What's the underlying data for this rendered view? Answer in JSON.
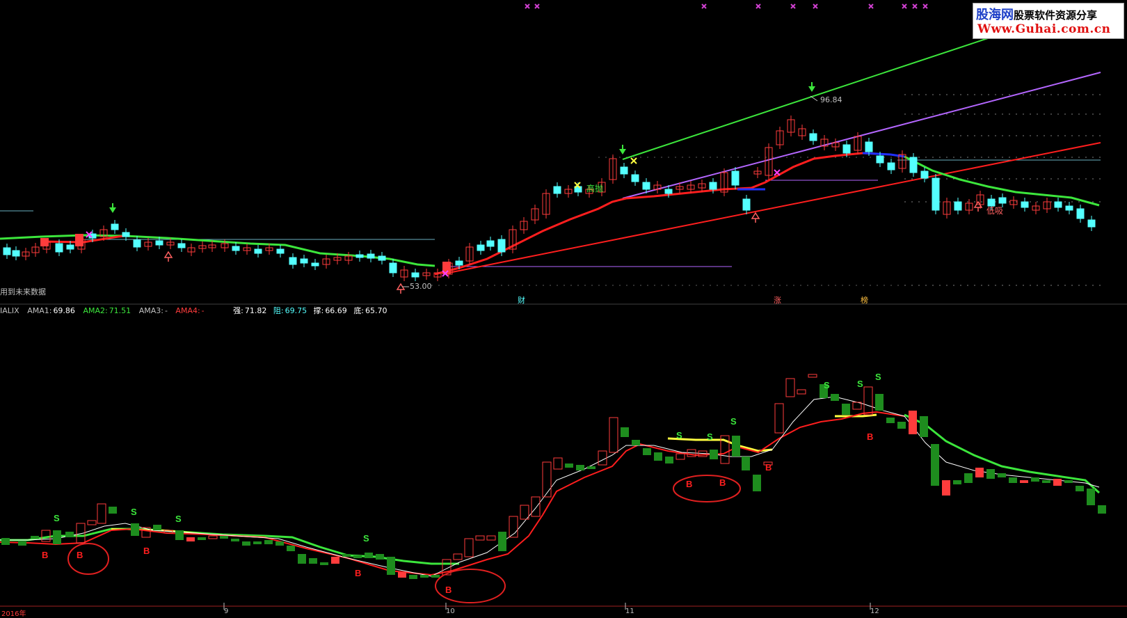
{
  "watermark": {
    "line1_a": "股海网",
    "line1_b": "股票软件资源分享",
    "line2": "Www.Guhai.com.cn"
  },
  "main_panel": {
    "note_left": "用到未来数据",
    "price_high_label": "96.84",
    "price_low_label": "53.00",
    "label_high_sell": "高抛",
    "label_low_buy": "低吸",
    "event_labels": [
      "财",
      "涨",
      "榜"
    ]
  },
  "indicator_bar": {
    "name": "IALIX",
    "ama1_label": "AMA1:",
    "ama1_value": "69.86",
    "ama2_label": "AMA2:",
    "ama2_value": "71.51",
    "ama3_label": "AMA3:",
    "ama3_value": "-",
    "ama4_label": "AMA4:",
    "ama4_value": "-",
    "qiang_label": "强:",
    "qiang_value": "71.82",
    "zu_label": "阻:",
    "zu_value": "69.75",
    "cheng_label": "撑:",
    "cheng_value": "66.69",
    "di_label": "底:",
    "di_value": "65.70"
  },
  "sub_panel": {
    "signal_s": "S",
    "signal_b": "B"
  },
  "time_axis": {
    "labels": [
      "2016年",
      "9",
      "10",
      "11",
      "12"
    ]
  },
  "colors": {
    "background": "#000000",
    "up_candle": "#ff3c3c",
    "down_candle": "#54ffff",
    "sub_down": "#1e8c1e",
    "ama_green": "#3ce63c",
    "ama_red": "#ff1e1e",
    "ama_white": "#ffffff",
    "channel_purple": "#b466ff",
    "ama2_text": "#3ce63c",
    "ama4_text": "#ff3c3c",
    "zu_text": "#54ffff"
  }
}
